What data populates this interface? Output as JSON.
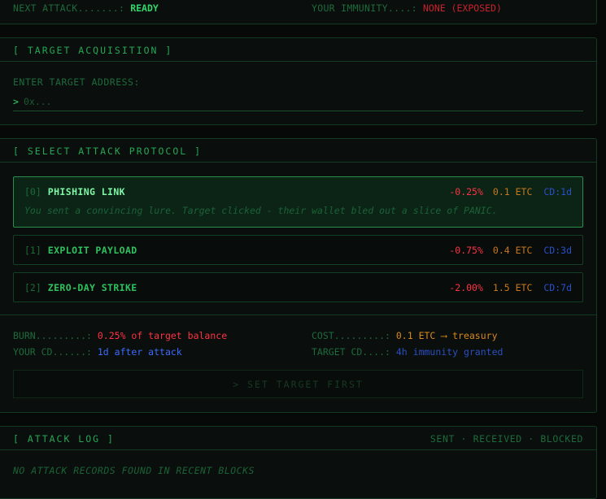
{
  "status": {
    "next_attack_label": "NEXT ATTACK.......:",
    "next_attack_value": "READY",
    "immunity_label": "YOUR IMMUNITY....:",
    "immunity_value": "NONE (EXPOSED)"
  },
  "target": {
    "header": "[ TARGET ACQUISITION ]",
    "input_label": "ENTER TARGET ADDRESS:",
    "prompt": ">",
    "placeholder": "0x..."
  },
  "protocol": {
    "header": "[ SELECT ATTACK PROTOCOL ]",
    "attacks": [
      {
        "index": "[0]",
        "name": "PHISHING LINK",
        "burn": "-0.25%",
        "cost": "0.1 ETC",
        "cd": "CD:1d",
        "description": "You sent a convincing lure. Target clicked - their wallet bled out a slice of PANIC.",
        "selected": true
      },
      {
        "index": "[1]",
        "name": "EXPLOIT PAYLOAD",
        "burn": "-0.75%",
        "cost": "0.4 ETC",
        "cd": "CD:3d",
        "selected": false
      },
      {
        "index": "[2]",
        "name": "ZERO-DAY STRIKE",
        "burn": "-2.00%",
        "cost": "1.5 ETC",
        "cd": "CD:7d",
        "selected": false
      }
    ],
    "summary": {
      "burn_label": "BURN.........:",
      "burn_value": "0.25% of target balance",
      "cost_label": "COST.........:",
      "cost_value": "0.1 ETC ⟶ treasury",
      "your_cd_label": "YOUR CD......:",
      "your_cd_value": "1d after attack",
      "target_cd_label": "TARGET CD....:",
      "target_cd_value": "4h immunity granted"
    },
    "submit_label": "> SET TARGET FIRST"
  },
  "log": {
    "header": "[ ATTACK LOG ]",
    "filters": "SENT · RECEIVED · BLOCKED",
    "empty_message": "NO ATTACK RECORDS FOUND IN RECENT BLOCKS"
  }
}
